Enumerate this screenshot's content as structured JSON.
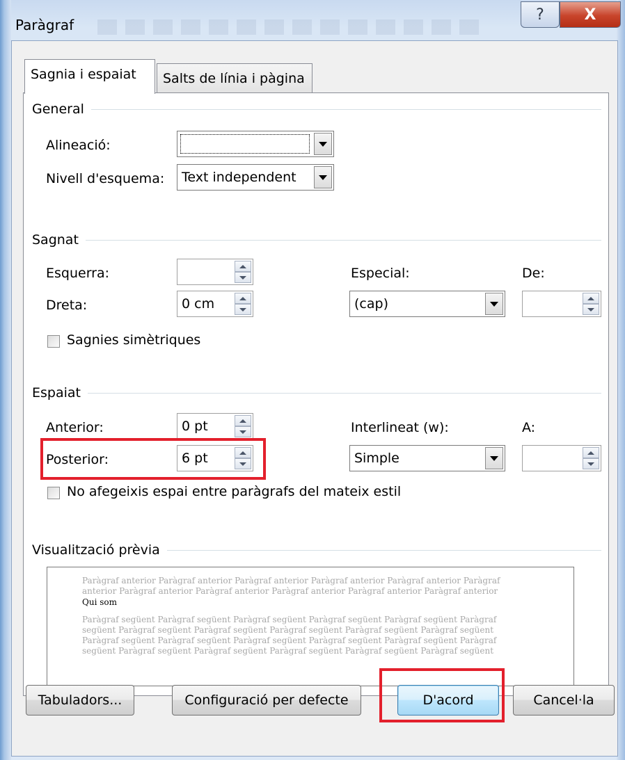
{
  "window": {
    "title": "Paràgraf"
  },
  "caption_buttons": {
    "help": "?",
    "close": "X"
  },
  "tabs": [
    {
      "label": "Sagnia i espaiat",
      "active": true
    },
    {
      "label": "Salts de línia i pàgina",
      "active": false
    }
  ],
  "general": {
    "heading": "General",
    "alineacio_label": "Alineació:",
    "alineacio_value": "",
    "nivell_label": "Nivell d'esquema:",
    "nivell_value": "Text independent"
  },
  "sagnat": {
    "heading": "Sagnat",
    "esquerra_label": "Esquerra:",
    "esquerra_value": "",
    "dreta_label": "Dreta:",
    "dreta_value": "0 cm",
    "especial_label": "Especial:",
    "especial_value": "(cap)",
    "de_label": "De:",
    "de_value": "",
    "simetriques_label": "Sagnies simètriques",
    "simetriques_checked": false
  },
  "espaiat": {
    "heading": "Espaiat",
    "anterior_label": "Anterior:",
    "anterior_value": "0 pt",
    "posterior_label": "Posterior:",
    "posterior_value": "6 pt",
    "interlineat_label": "Interlineat (w):",
    "interlineat_value": "Simple",
    "a_label": "A:",
    "a_value": "",
    "no_afegeixis_label": "No afegeixis espai entre paràgrafs del mateix estil",
    "no_afegeixis_checked": false
  },
  "preview": {
    "heading": "Visualització prèvia",
    "before_lines": [
      "Paràgraf anterior Paràgraf anterior Paràgraf anterior Paràgraf anterior Paràgraf anterior Paràgraf",
      "anterior Paràgraf anterior Paràgraf anterior Paràgraf anterior Paràgraf anterior Paràgraf anterior"
    ],
    "current": "Qui som",
    "after_lines": [
      "Paràgraf següent Paràgraf següent Paràgraf següent Paràgraf següent Paràgraf següent Paràgraf",
      "següent Paràgraf següent Paràgraf següent Paràgraf següent Paràgraf següent Paràgraf següent",
      "Paràgraf següent Paràgraf següent Paràgraf següent Paràgraf següent Paràgraf següent Paràgraf",
      "següent Paràgraf següent Paràgraf següent Paràgraf següent Paràgraf següent Paràgraf següent"
    ]
  },
  "buttons": {
    "tabuladors": "Tabuladors...",
    "configuracio": "Configuració per defecte",
    "dacord": "D'acord",
    "cancel": "Cancel·la"
  },
  "colors": {
    "highlight": "#e3202c",
    "panel": "#ffffff",
    "dialog": "#f0f0f0"
  }
}
